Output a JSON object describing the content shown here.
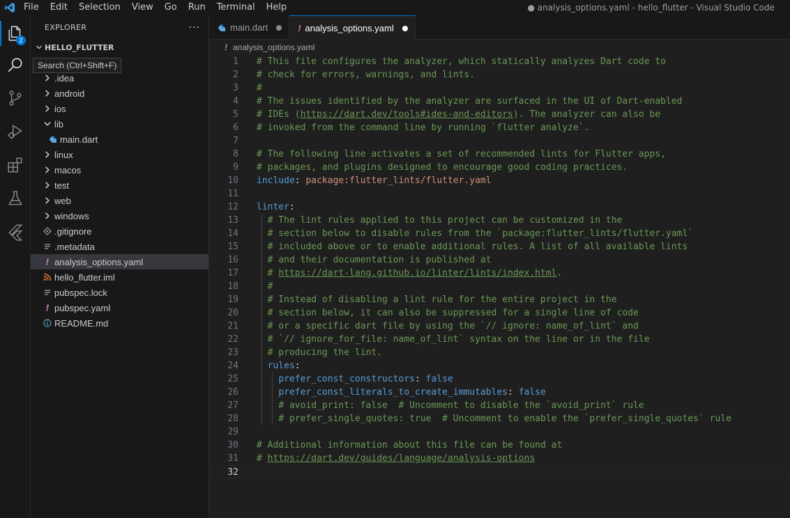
{
  "titlebar": {
    "menu": [
      "File",
      "Edit",
      "Selection",
      "View",
      "Go",
      "Run",
      "Terminal",
      "Help"
    ],
    "window_title": "● analysis_options.yaml - hello_flutter - Visual Studio Code"
  },
  "activity_bar": {
    "explorer_badge": "2",
    "tooltip": "Search (Ctrl+Shift+F)"
  },
  "sidebar": {
    "title": "EXPLORER",
    "more": "···",
    "project": "HELLO_FLUTTER",
    "items": [
      {
        "label": ".idea",
        "kind": "folder"
      },
      {
        "label": "android",
        "kind": "folder"
      },
      {
        "label": "ios",
        "kind": "folder"
      },
      {
        "label": "lib",
        "kind": "folder-open"
      },
      {
        "label": "main.dart",
        "kind": "dart"
      },
      {
        "label": "linux",
        "kind": "folder"
      },
      {
        "label": "macos",
        "kind": "folder"
      },
      {
        "label": "test",
        "kind": "folder"
      },
      {
        "label": "web",
        "kind": "folder"
      },
      {
        "label": "windows",
        "kind": "folder"
      },
      {
        "label": ".gitignore",
        "kind": "git"
      },
      {
        "label": ".metadata",
        "kind": "lines"
      },
      {
        "label": "analysis_options.yaml",
        "kind": "yaml"
      },
      {
        "label": "hello_flutter.iml",
        "kind": "rss"
      },
      {
        "label": "pubspec.lock",
        "kind": "lines"
      },
      {
        "label": "pubspec.yaml",
        "kind": "yaml"
      },
      {
        "label": "README.md",
        "kind": "info"
      }
    ]
  },
  "tabs": [
    {
      "label": "main.dart",
      "active": false
    },
    {
      "label": "analysis_options.yaml",
      "active": true
    }
  ],
  "breadcrumb": {
    "icon": "!",
    "file": "analysis_options.yaml"
  },
  "editor": {
    "current_line": 32,
    "lines": [
      {
        "n": "1",
        "t": "# This file configures the analyzer, which statically analyzes Dart code to"
      },
      {
        "n": "2",
        "t": "# check for errors, warnings, and lints."
      },
      {
        "n": "3",
        "t": "#"
      },
      {
        "n": "4",
        "t": "# The issues identified by the analyzer are surfaced in the UI of Dart-enabled"
      },
      {
        "n": "5",
        "t": "# IDEs (https://dart.dev/tools#ides-and-editors). The analyzer can also be"
      },
      {
        "n": "6",
        "t": "# invoked from the command line by running `flutter analyze`."
      },
      {
        "n": "7",
        "t": ""
      },
      {
        "n": "8",
        "t": "# The following line activates a set of recommended lints for Flutter apps,"
      },
      {
        "n": "9",
        "t": "# packages, and plugins designed to encourage good coding practices."
      },
      {
        "n": "10",
        "t": "include: package:flutter_lints/flutter.yaml"
      },
      {
        "n": "11",
        "t": ""
      },
      {
        "n": "12",
        "t": "linter:"
      },
      {
        "n": "13",
        "t": "  # The lint rules applied to this project can be customized in the"
      },
      {
        "n": "14",
        "t": "  # section below to disable rules from the `package:flutter_lints/flutter.yaml`"
      },
      {
        "n": "15",
        "t": "  # included above or to enable additional rules. A list of all available lints"
      },
      {
        "n": "16",
        "t": "  # and their documentation is published at"
      },
      {
        "n": "17",
        "t": "  # https://dart-lang.github.io/linter/lints/index.html."
      },
      {
        "n": "18",
        "t": "  #"
      },
      {
        "n": "19",
        "t": "  # Instead of disabling a lint rule for the entire project in the"
      },
      {
        "n": "20",
        "t": "  # section below, it can also be suppressed for a single line of code"
      },
      {
        "n": "21",
        "t": "  # or a specific dart file by using the `// ignore: name_of_lint` and"
      },
      {
        "n": "22",
        "t": "  # `// ignore_for_file: name_of_lint` syntax on the line or in the file"
      },
      {
        "n": "23",
        "t": "  # producing the lint."
      },
      {
        "n": "24",
        "t": "  rules:"
      },
      {
        "n": "25",
        "t": "    prefer_const_constructors: false"
      },
      {
        "n": "26",
        "t": "    prefer_const_literals_to_create_immutables: false"
      },
      {
        "n": "27",
        "t": "    # avoid_print: false  # Uncomment to disable the `avoid_print` rule"
      },
      {
        "n": "28",
        "t": "    # prefer_single_quotes: true  # Uncomment to enable the `prefer_single_quotes` rule"
      },
      {
        "n": "29",
        "t": ""
      },
      {
        "n": "30",
        "t": "# Additional information about this file can be found at"
      },
      {
        "n": "31",
        "t": "# https://dart.dev/guides/language/analysis-options"
      },
      {
        "n": "32",
        "t": ""
      }
    ]
  },
  "colors": {
    "accent": "#0078d4",
    "comment": "#6a9955",
    "keyword": "#569cd6",
    "string": "#ce9178",
    "yaml_icon": "#c586c0"
  }
}
